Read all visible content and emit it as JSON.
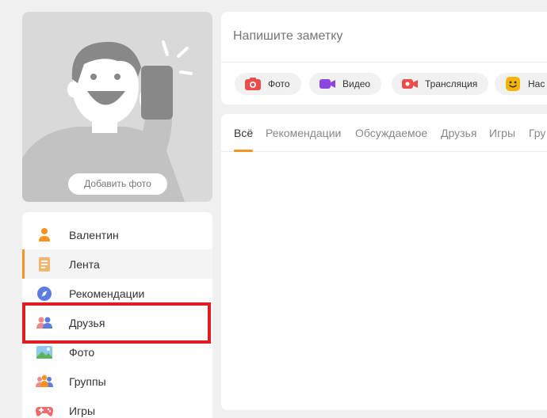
{
  "profile": {
    "add_photo_label": "Добавить фото"
  },
  "menu": {
    "items": [
      {
        "label": "Валентин",
        "icon": "user-icon"
      },
      {
        "label": "Лента",
        "icon": "feed-icon"
      },
      {
        "label": "Рекомендации",
        "icon": "compass-icon"
      },
      {
        "label": "Друзья",
        "icon": "friends-icon"
      },
      {
        "label": "Фото",
        "icon": "photo-icon"
      },
      {
        "label": "Группы",
        "icon": "groups-icon"
      },
      {
        "label": "Игры",
        "icon": "gamepad-icon"
      }
    ],
    "active_index": 1,
    "highlighted_index": 3
  },
  "composer": {
    "placeholder": "Напишите заметку",
    "actions": [
      {
        "label": "Фото",
        "icon": "camera-icon"
      },
      {
        "label": "Видео",
        "icon": "video-camera-icon"
      },
      {
        "label": "Трансляция",
        "icon": "live-stream-icon"
      },
      {
        "label": "Нас",
        "icon": "smile-icon"
      }
    ]
  },
  "feed": {
    "tabs": [
      "Всё",
      "Рекомендации",
      "Обсуждаемое",
      "Друзья",
      "Игры",
      "Гру"
    ],
    "active_tab_index": 0
  },
  "colors": {
    "accent": "#f7931e",
    "highlight": "#e01e1e"
  }
}
